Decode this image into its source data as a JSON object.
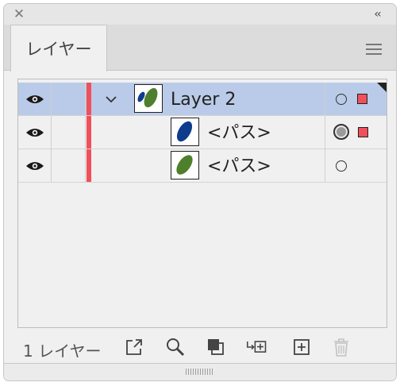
{
  "panel": {
    "tab_label": "レイヤー",
    "close_icon": "close-icon",
    "collapse_icon": "double-chevron-left-icon",
    "menu_icon": "hamburger-menu-icon"
  },
  "colors": {
    "selection_bg": "#b9cbe8",
    "layer_color": "#f0505a",
    "leaf_blue": "#0e3c8c",
    "leaf_green": "#4e7f2c"
  },
  "layers": [
    {
      "name": "Layer 2",
      "expanded": true,
      "selected": true,
      "thumbnail": "blue-and-green-leaves",
      "children": [
        {
          "name": "<パス>",
          "thumbnail": "blue-leaf",
          "target_active": true,
          "selection_square": true
        },
        {
          "name": "<パス>",
          "thumbnail": "green-leaf",
          "target_active": false,
          "selection_square": false
        }
      ]
    }
  ],
  "footer": {
    "layer_count": "1 レイヤー",
    "buttons": [
      "export-icon",
      "locate-object-icon",
      "clipping-mask-icon",
      "new-sublayer-icon",
      "new-layer-icon",
      "delete-icon"
    ]
  }
}
